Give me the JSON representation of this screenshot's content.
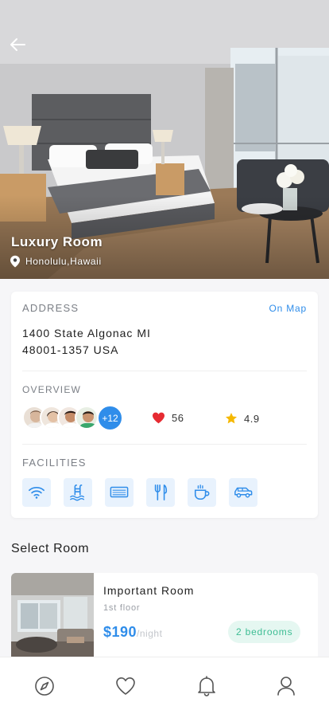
{
  "hero": {
    "title": "Luxury Room",
    "location": "Honolulu,Hawaii"
  },
  "address": {
    "label": "ADDRESS",
    "map_link": "On Map",
    "line1": "1400 State Algonac MI",
    "line2": "48001-1357 USA"
  },
  "overview": {
    "label": "OVERVIEW",
    "more_count": "+12",
    "likes": "56",
    "rating": "4.9"
  },
  "facilities": {
    "label": "FACILITIES",
    "items": [
      "wifi-icon",
      "pool-icon",
      "air-conditioner-icon",
      "restaurant-icon",
      "coffee-icon",
      "car-icon"
    ]
  },
  "select_room": {
    "title": "Select Room",
    "room": {
      "name": "Important Room",
      "floor": "1st floor",
      "price": "$190",
      "per": "/night",
      "badge": "2 bedrooms"
    }
  },
  "nav": {
    "items": [
      "compass-icon",
      "heart-icon",
      "bell-icon",
      "profile-icon"
    ]
  },
  "colors": {
    "accent": "#2f8dea",
    "badge_bg": "#e5f7f1",
    "badge_text": "#3ebd94",
    "heart": "#e62b32",
    "star": "#f5b800"
  }
}
